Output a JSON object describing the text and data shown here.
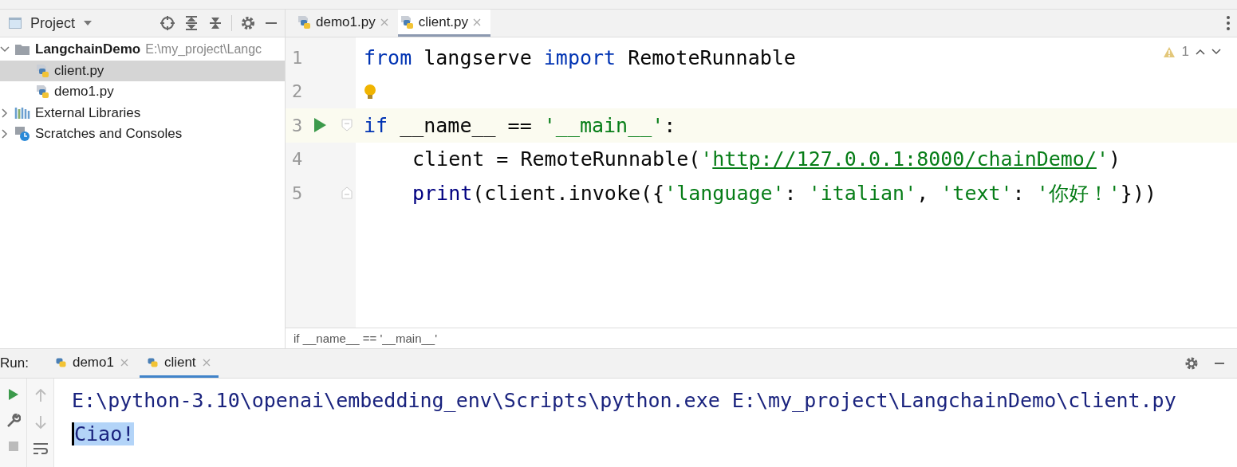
{
  "project_panel": {
    "title": "Project",
    "tree": [
      {
        "label": "LangchainDemo",
        "path": "E:\\my_project\\Langc",
        "kind": "folder",
        "expanded": true,
        "children": [
          {
            "label": "client.py",
            "kind": "python",
            "selected": true
          },
          {
            "label": "demo1.py",
            "kind": "python",
            "selected": false
          }
        ]
      },
      {
        "label": "External Libraries",
        "kind": "library",
        "expanded": false
      },
      {
        "label": "Scratches and Consoles",
        "kind": "scratch",
        "expanded": false
      }
    ]
  },
  "editor": {
    "tabs": [
      {
        "label": "demo1.py",
        "selected": false
      },
      {
        "label": "client.py",
        "selected": true
      }
    ],
    "inspection_count": "1",
    "lines": [
      {
        "number": "1",
        "tokens": [
          {
            "kind": "keyword",
            "text": "from"
          },
          {
            "kind": "plain",
            "text": " langserve "
          },
          {
            "kind": "keyword",
            "text": "import"
          },
          {
            "kind": "plain",
            "text": " RemoteRunnable"
          }
        ]
      },
      {
        "number": "2",
        "bulb": true
      },
      {
        "number": "3",
        "current": true,
        "run_marker": true,
        "fold_start": true,
        "tokens": [
          {
            "kind": "keyword",
            "text": "if"
          },
          {
            "kind": "plain",
            "text": " __name__ == "
          },
          {
            "kind": "string",
            "text": "'__main__'"
          },
          {
            "kind": "plain",
            "text": ":"
          }
        ]
      },
      {
        "number": "4",
        "indented": true,
        "tokens": [
          {
            "kind": "plain",
            "text": "client = RemoteRunnable("
          },
          {
            "kind": "string",
            "text": "'"
          },
          {
            "kind": "url",
            "text": "http://127.0.0.1:8000/chainDemo/"
          },
          {
            "kind": "string",
            "text": "'"
          },
          {
            "kind": "plain",
            "text": ")"
          }
        ]
      },
      {
        "number": "5",
        "indented": true,
        "fold_end": true,
        "tokens": [
          {
            "kind": "builtin",
            "text": "print"
          },
          {
            "kind": "plain",
            "text": "(client.invoke({"
          },
          {
            "kind": "string",
            "text": "'language'"
          },
          {
            "kind": "plain",
            "text": ": "
          },
          {
            "kind": "string",
            "text": "'italian'"
          },
          {
            "kind": "plain",
            "text": ", "
          },
          {
            "kind": "string",
            "text": "'text'"
          },
          {
            "kind": "plain",
            "text": ": "
          },
          {
            "kind": "string",
            "text": "'你好！'"
          },
          {
            "kind": "plain",
            "text": "}))"
          }
        ]
      }
    ],
    "breadcrumb": "if __name__ == '__main__'"
  },
  "run_panel": {
    "label": "Run:",
    "tabs": [
      {
        "label": "demo1",
        "selected": false
      },
      {
        "label": "client",
        "selected": true
      }
    ],
    "output": [
      {
        "text": "E:\\python-3.10\\openai\\embedding_env\\Scripts\\python.exe E:\\my_project\\LangchainDemo\\client.py",
        "selected": false
      },
      {
        "text": "Ciao!",
        "selected": true
      }
    ]
  }
}
